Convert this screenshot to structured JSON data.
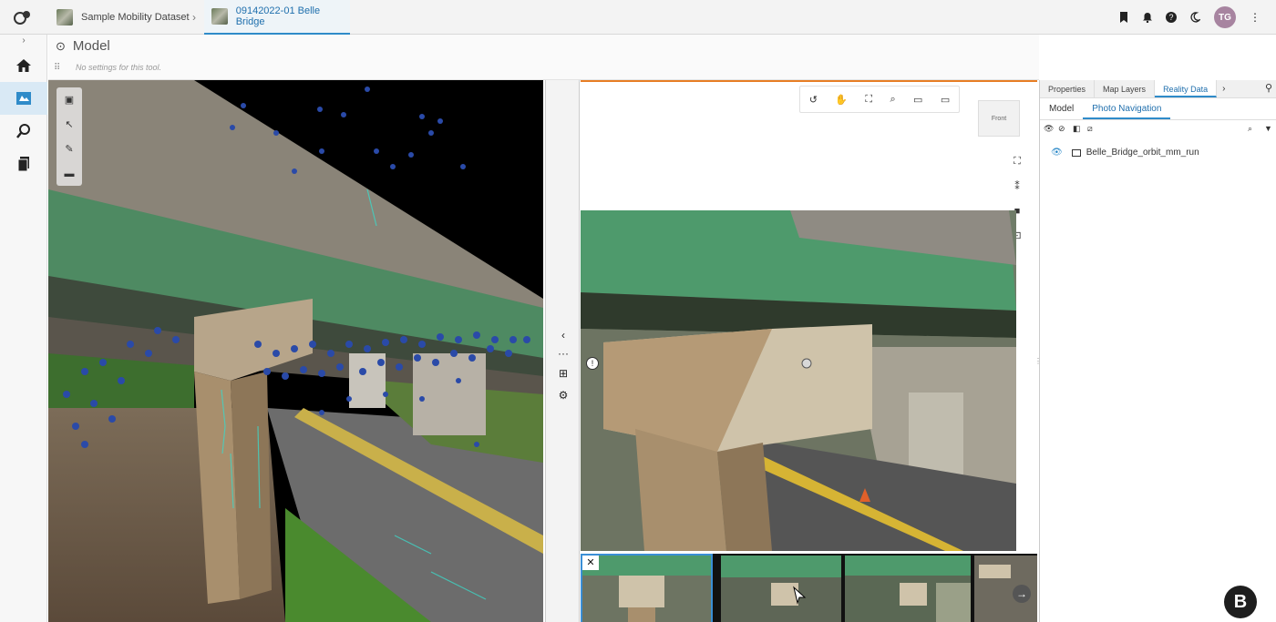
{
  "topbar": {
    "breadcrumb": [
      {
        "label": "Sample Mobility Dataset"
      },
      {
        "label": "09142022-01 Belle Bridge"
      }
    ],
    "user_initials": "TG"
  },
  "tool": {
    "title": "Model",
    "note": "No settings for this tool."
  },
  "photo_panel": {
    "front_label": "Front"
  },
  "right_panel": {
    "tabs": [
      "Properties",
      "Map Layers",
      "Reality Data"
    ],
    "active_tab": "Reality Data",
    "subtabs": [
      "Model",
      "Photo Navigation"
    ],
    "active_subtab": "Photo Navigation",
    "items": [
      {
        "label": "Belle_Bridge_orbit_mm_run"
      }
    ]
  },
  "brand_badge": "B",
  "colors": {
    "accent": "#2f8bc9",
    "active_tab_text": "#1f6fad",
    "highlight_border": "#e77d24",
    "avatar": "#a784a0",
    "point_markers": "#2a4aa8"
  }
}
